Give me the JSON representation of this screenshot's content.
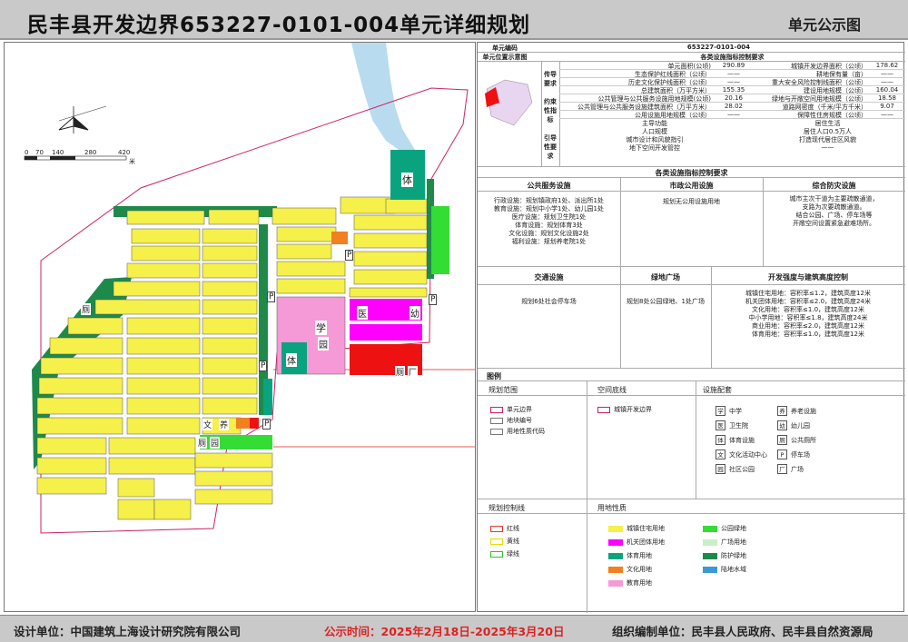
{
  "title": "民丰县开发边界653227-0101-004单元详细规划",
  "subtitle": "单元公示图",
  "footer": {
    "designer": "设计单位：中国建筑上海设计研究院有限公司",
    "period": "公示时间：2025年2月18日-2025年3月20日",
    "organizer": "组织编制单位：民丰县人民政府、民丰县自然资源局"
  },
  "map": {
    "scale_ticks": [
      "0",
      "70",
      "140",
      "280",
      "420"
    ],
    "scale_unit": "米",
    "labels": {
      "ti1": "体",
      "ti2": "体",
      "xue": "学",
      "yuan": "园",
      "yi": "医",
      "you": "幼",
      "ce1": "厕",
      "ce2": "厕",
      "guang": "厂",
      "wen": "文",
      "yang": "养",
      "ce3": "厕",
      "yuan2": "园",
      "p1": "P",
      "p2": "P",
      "p3": "P",
      "p4": "P",
      "p5": "P"
    },
    "codes": {
      "residential": "0701",
      "school": "0804",
      "hospital": "0806",
      "sport": "0803",
      "green": "1401",
      "road": "1207",
      "a": "1402",
      "b": "0802",
      "c": "1203",
      "d": "1404"
    }
  },
  "table": {
    "unit_no_label": "单元编码",
    "unit_no": "653227-0101-004",
    "loc_label": "单元位置示意图",
    "section_title": "各类设施指标控制要求",
    "groups": [
      "传导要求",
      "约束性指标",
      "引导性要求"
    ],
    "rows": [
      [
        "单元面积(公顷)",
        "290.89",
        "城镇开发边界面积（公顷）",
        "178.62"
      ],
      [
        "生态保护红线面积（公顷）",
        "——",
        "耕地保有量（亩）",
        "——"
      ],
      [
        "历史文化保护线面积（公顷）",
        "——",
        "重大安全风险控制线面积（公顷）",
        "——"
      ],
      [
        "总建筑面积（万平方米）",
        "155.35",
        "建设用地规模（公顷）",
        "160.04"
      ],
      [
        "公共管理与公共服务设施用地规模(公顷)",
        "20.16",
        "绿地与开敞空间用地规模（公顷）",
        "18.58"
      ],
      [
        "公共管理与公共服务设施建筑面积（万平方米）",
        "28.02",
        "道路网密度（千米/平方千米）",
        "9.07"
      ],
      [
        "公用设施用地规模（公顷）",
        "——",
        "保障性住房规模（公顷）",
        "——"
      ]
    ],
    "guide": [
      [
        "主导功能",
        "居住生活"
      ],
      [
        "人口规模",
        "居住人口0.5万人"
      ],
      [
        "城市设计和风貌指引",
        "打造现代居住区风貌"
      ],
      [
        "地下空间开发管控",
        "——"
      ]
    ],
    "fac_title": "各类设施指标控制要求",
    "fac_heads": [
      "公共服务设施",
      "市政公用设施",
      "综合防灾设施"
    ],
    "public_service": [
      "行政设施：规划镇政府1处、派出所1处",
      "教育设施：规划中小学1处、幼儿园1处",
      "医疗设施：规划卫生院1处",
      "体育设施：规划体育3处",
      "文化设施：规划文化设施2处",
      "福利设施：规划养老院1处"
    ],
    "municipal": "规划无公用设施用地",
    "disaster": [
      "城市主次干道为主要疏散通道，",
      "支路为次要疏散通道。",
      "结合公园、广场、停车场等",
      "开敞空间设置紧急避难场所。"
    ],
    "fac_heads2": [
      "交通设施",
      "绿地广场",
      "开发强度与建筑高度控制"
    ],
    "traffic": "规划6处社会停车场",
    "greens": "规划8处公园绿地、1处广场",
    "intensity": [
      "城镇住宅用地：容积率≤1.2，建筑高度12米",
      "机关团体用地：容积率≤2.0，建筑高度24米",
      "文化用地：容积率≤1.0，建筑高度12米",
      "中小学用地：容积率≤1.8，建筑高度24米",
      "商业用地：容积率≤2.0，建筑高度12米",
      "体育用地：容积率≤1.0，建筑高度12米"
    ]
  },
  "legend": {
    "title": "图例",
    "scope_title": "规划范围",
    "scope": [
      "单元边界",
      "地块编号",
      "用地性质代码"
    ],
    "space_title": "空间底线",
    "space": [
      "城镇开发边界"
    ],
    "fac_title": "设施配套",
    "fac_left": [
      [
        "学",
        "中学"
      ],
      [
        "医",
        "卫生院"
      ],
      [
        "体",
        "体育设施"
      ],
      [
        "文",
        "文化活动中心"
      ],
      [
        "园",
        "社区公园"
      ]
    ],
    "fac_right": [
      [
        "养",
        "养老设施"
      ],
      [
        "幼",
        "幼儿园"
      ],
      [
        "厕",
        "公共厕所"
      ],
      [
        "P",
        "停车场"
      ],
      [
        "厂",
        "广场"
      ]
    ],
    "ctrl_title": "规划控制线",
    "ctrl": [
      "红线",
      "黄线",
      "绿线"
    ],
    "land_title": "用地性质",
    "land_left": [
      "城镇住宅用地",
      "机关团体用地",
      "体育用地",
      "文化用地",
      "教育用地"
    ],
    "land_right": [
      "公园绿地",
      "广场用地",
      "防护绿地",
      "陆地水域"
    ],
    "colors": {
      "residential": "#f5f04a",
      "gov": "#ff00ff",
      "sport": "#0aa37f",
      "culture": "#f08020",
      "edu": "#f59ad6",
      "park": "#33dd33",
      "square": "#c8f0c8",
      "shelter": "#1e8a4a",
      "water": "#3a9ad6",
      "hospital": "#ee1111"
    }
  }
}
